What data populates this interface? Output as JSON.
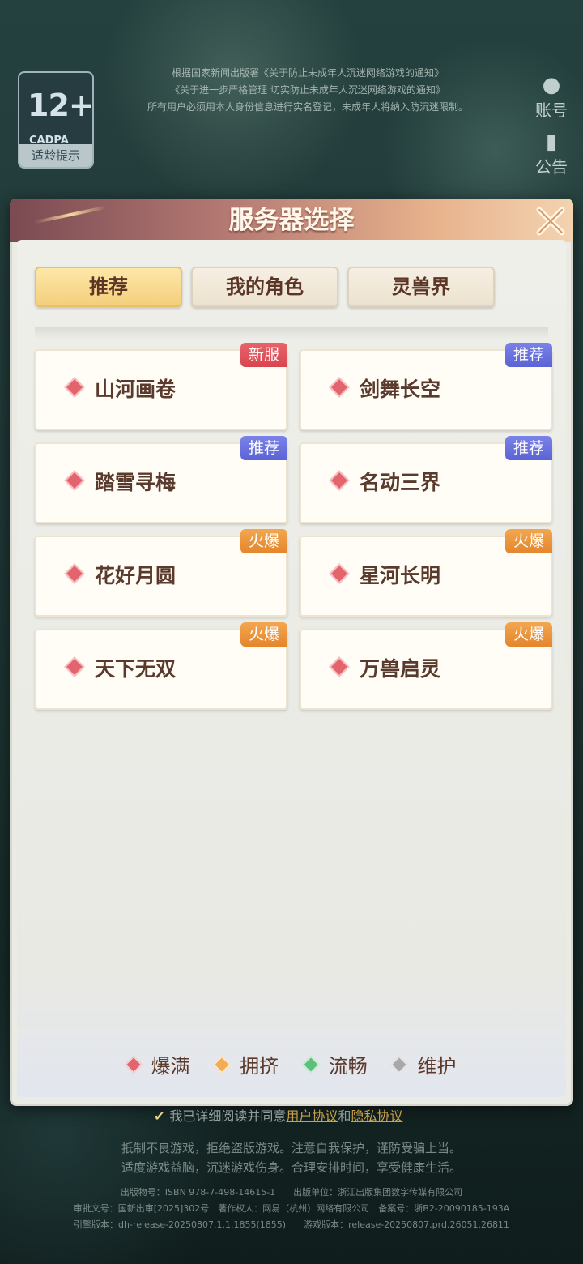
{
  "notice": {
    "line1": "根据国家新闻出版署《关于防止未成年人沉迷网络游戏的通知》",
    "line2": "《关于进一步严格管理 切实防止未成年人沉迷网络游戏的通知》",
    "line3": "所有用户必须用本人身份信息进行实名登记，未成年人将纳入防沉迷限制。"
  },
  "age_badge": {
    "number": "12+",
    "org": "CADPA",
    "tip": "适龄提示"
  },
  "side": {
    "account": "账号",
    "announcement": "公告"
  },
  "dialog": {
    "title": "服务器选择",
    "tabs": [
      "推荐",
      "我的角色",
      "灵兽界"
    ],
    "servers": [
      {
        "name": "山河画卷",
        "tag": "新服",
        "status": "爆满"
      },
      {
        "name": "剑舞长空",
        "tag": "推荐",
        "status": "爆满"
      },
      {
        "name": "踏雪寻梅",
        "tag": "推荐",
        "status": "爆满"
      },
      {
        "name": "名动三界",
        "tag": "推荐",
        "status": "爆满"
      },
      {
        "name": "花好月圆",
        "tag": "火爆",
        "status": "爆满"
      },
      {
        "name": "星河长明",
        "tag": "火爆",
        "status": "爆满"
      },
      {
        "name": "天下无双",
        "tag": "火爆",
        "status": "爆满"
      },
      {
        "name": "万兽启灵",
        "tag": "火爆",
        "status": "爆满"
      }
    ],
    "legend": [
      {
        "label": "爆满",
        "color": "#e2646c"
      },
      {
        "label": "拥挤",
        "color": "#f2ad52"
      },
      {
        "label": "流畅",
        "color": "#5cc07a"
      },
      {
        "label": "维护",
        "color": "#a8a8a8"
      }
    ]
  },
  "colors": {
    "tag_new": "#d8454f",
    "tag_rec": "#5b63d6",
    "tag_hot": "#e5852c"
  },
  "footer": {
    "agree_prefix": "我已详细阅读并同意",
    "agree_user": "用户协议",
    "agree_and": "和",
    "agree_privacy": "隐私协议",
    "health1": "抵制不良游戏，拒绝盗版游戏。注意自我保护，谨防受骗上当。",
    "health2": "适度游戏益脑，沉迷游戏伤身。合理安排时间，享受健康生活。",
    "publish": "出版物号：ISBN 978-7-498-14615-1　　出版单位：浙江出版集团数字传媒有限公司",
    "approval": "审批文号：国新出审[2025]302号　著作权人：网易（杭州）网络有限公司　备案号：浙B2-20090185-193A",
    "version": "引擎版本：dh-release-20250807.1.1.1855(1855)　　游戏版本：release-20250807.prd.26051.26811"
  }
}
